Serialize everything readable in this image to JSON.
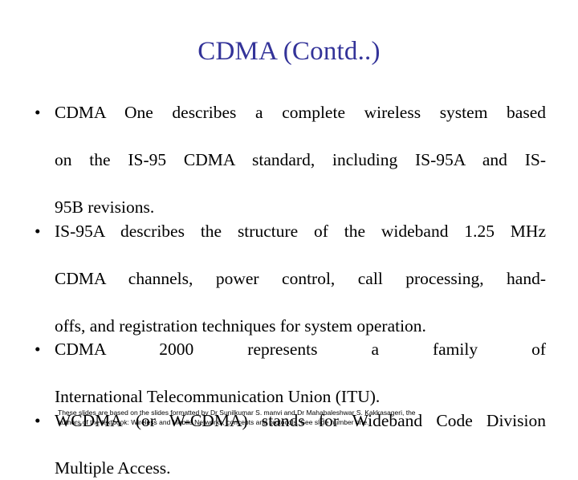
{
  "slide": {
    "title": "CDMA (Contd..)",
    "title_color": "#333399",
    "background_color": "#ffffff",
    "body_text_color": "#000000",
    "bullet_marker": "•",
    "bullets": [
      {
        "id": "bullet-cdma-one",
        "text": "CDMA One describes a complete wireless system based on the IS-95 CDMA standard, including IS-95A and IS-95B revisions.",
        "line1": "CDMA One describes a complete wireless system based",
        "line2": "on the IS-95 CDMA standard, including IS-95A and IS-",
        "line3": "95B revisions."
      },
      {
        "id": "bullet-is-95a",
        "text": "IS-95A describes the structure of the wideband 1.25 MHz CDMA channels, power control, call processing, hand-offs, and registration techniques for system operation.",
        "line1": "IS-95A describes the structure of the wideband 1.25 MHz",
        "line2": "CDMA channels, power control, call processing, hand-",
        "line3": "offs, and registration techniques for system operation."
      },
      {
        "id": "bullet-cdma-2000",
        "text": "CDMA 2000 represents a family of International Telecommunication Union (ITU).",
        "line1": "CDMA 2000 represents a family of",
        "line2": "International Telecommunication Union (ITU)."
      },
      {
        "id": "bullet-wcdma",
        "text": "WCDMA (or W-CDMA) stands for Wideband Code Division Multiple Access.",
        "line1": "WCDMA (or W-CDMA) stands for Wideband Code Division",
        "line2": "Multiple Access."
      }
    ],
    "footer": {
      "line1": "These slides are based on the slides formatted by Dr Sunilkumar S. manvi and Dr Mahabaleshwar S. Kakkasageri, the",
      "line2": "authors of the textbook: Wireless and Mobile Networks, concepts and protocols. See slide number one."
    }
  }
}
